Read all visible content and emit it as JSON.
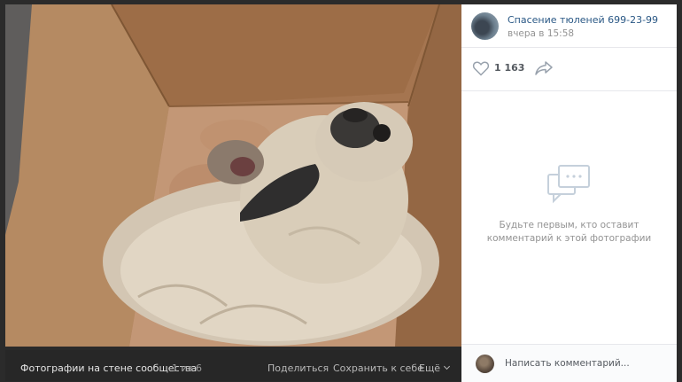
{
  "viewer": {
    "album_label": "Фотографии на стене сообщества",
    "counter": "1 из 6",
    "share_label": "Поделиться",
    "save_label": "Сохранить к себе",
    "more_label": "Ещё",
    "separator": "·"
  },
  "photo": {
    "subject_icon": "seal-pup-photo"
  },
  "sidebar": {
    "author_name": "Спасение тюленей 699-23-99",
    "author_date": "вчера в 15:58",
    "likes_count": "1 163",
    "like_icon": "heart-icon",
    "share_icon": "share-arrow-icon",
    "empty_comments_icon": "comments-icon",
    "empty_comments_line1": "Будьте первым, кто оставит",
    "empty_comments_line2": "комментарий к этой фотографии",
    "comment_placeholder": "Написать комментарий..."
  },
  "colors": {
    "link": "#2a5885",
    "muted": "#939393",
    "viewer_bg": "#272727",
    "cardboard": "#a97a55"
  }
}
